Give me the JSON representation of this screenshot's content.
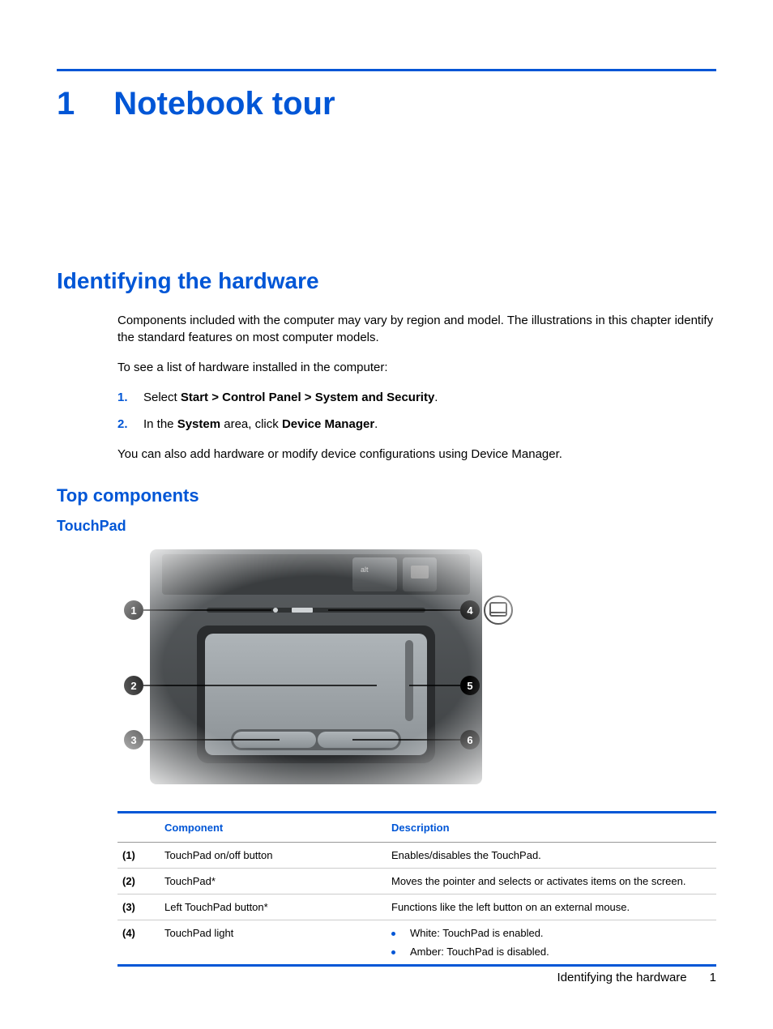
{
  "chapter": {
    "number": "1",
    "title": "Notebook tour"
  },
  "section": {
    "title": "Identifying the hardware"
  },
  "paragraphs": {
    "p1": "Components included with the computer may vary by region and model. The illustrations in this chapter identify the standard features on most computer models.",
    "p2": "To see a list of hardware installed in the computer:",
    "p3": "You can also add hardware or modify device configurations using Device Manager."
  },
  "steps": [
    {
      "num": "1.",
      "prefix": "Select ",
      "bold": "Start > Control Panel > System and Security",
      "suffix": "."
    },
    {
      "num": "2.",
      "prefix": "In the ",
      "bold1": "System",
      "mid": " area, click ",
      "bold2": "Device Manager",
      "suffix": "."
    }
  ],
  "h3": "Top components",
  "h4": "TouchPad",
  "table": {
    "headers": {
      "c1": "Component",
      "c2": "Description"
    },
    "rows": [
      {
        "num": "(1)",
        "name": "TouchPad on/off button",
        "desc": "Enables/disables the TouchPad."
      },
      {
        "num": "(2)",
        "name": "TouchPad*",
        "desc": "Moves the pointer and selects or activates items on the screen."
      },
      {
        "num": "(3)",
        "name": "Left TouchPad button*",
        "desc": "Functions like the left button on an external mouse."
      },
      {
        "num": "(4)",
        "name": "TouchPad light",
        "list": [
          "White: TouchPad is enabled.",
          "Amber: TouchPad is disabled."
        ]
      }
    ]
  },
  "footer": {
    "text": "Identifying the hardware",
    "page": "1"
  }
}
